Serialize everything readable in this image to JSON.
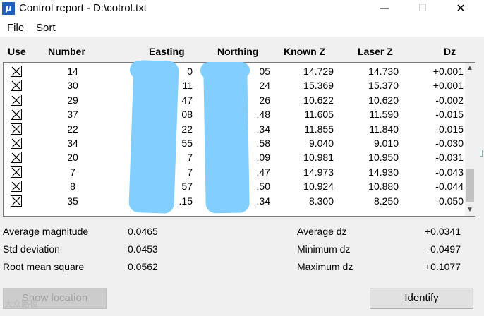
{
  "window": {
    "title": "Control report - D:\\cotrol.txt",
    "app_icon_glyph": "μ",
    "min_glyph": "—",
    "max_glyph": "☐",
    "close_glyph": "✕"
  },
  "menu": {
    "file": "File",
    "sort": "Sort"
  },
  "columns": {
    "use": "Use",
    "number": "Number",
    "easting": "Easting",
    "northing": "Northing",
    "known_z": "Known Z",
    "laser_z": "Laser Z",
    "dz": "Dz"
  },
  "rows": [
    {
      "use": true,
      "number": "14",
      "easting": "0",
      "northing": "05",
      "known_z": "14.729",
      "laser_z": "14.730",
      "dz": "+0.001"
    },
    {
      "use": true,
      "number": "30",
      "easting": "11",
      "northing": "24",
      "known_z": "15.369",
      "laser_z": "15.370",
      "dz": "+0.001"
    },
    {
      "use": true,
      "number": "29",
      "easting": "47",
      "northing": "26",
      "known_z": "10.622",
      "laser_z": "10.620",
      "dz": "-0.002"
    },
    {
      "use": true,
      "number": "37",
      "easting": "08",
      "northing": ".48",
      "known_z": "11.605",
      "laser_z": "11.590",
      "dz": "-0.015"
    },
    {
      "use": true,
      "number": "22",
      "easting": "22",
      "northing": ".34",
      "known_z": "11.855",
      "laser_z": "11.840",
      "dz": "-0.015"
    },
    {
      "use": true,
      "number": "34",
      "easting": "55",
      "northing": ".58",
      "known_z": "9.040",
      "laser_z": "9.010",
      "dz": "-0.030"
    },
    {
      "use": true,
      "number": "20",
      "easting": "7",
      "northing": ".09",
      "known_z": "10.981",
      "laser_z": "10.950",
      "dz": "-0.031"
    },
    {
      "use": true,
      "number": "7",
      "easting": "7",
      "northing": ".47",
      "known_z": "14.973",
      "laser_z": "14.930",
      "dz": "-0.043"
    },
    {
      "use": true,
      "number": "8",
      "easting": "57",
      "northing": ".50",
      "known_z": "10.924",
      "laser_z": "10.880",
      "dz": "-0.044"
    },
    {
      "use": true,
      "number": "35",
      "easting": ".15",
      "northing": ".34",
      "known_z": "8.300",
      "laser_z": "8.250",
      "dz": "-0.050"
    }
  ],
  "scroll": {
    "up": "▲",
    "down": "▼"
  },
  "stats": {
    "avg_magnitude_label": "Average magnitude",
    "avg_magnitude_value": "0.0465",
    "std_dev_label": "Std deviation",
    "std_dev_value": "0.0453",
    "rms_label": "Root mean square",
    "rms_value": "0.0562",
    "avg_dz_label": "Average dz",
    "avg_dz_value": "+0.0341",
    "min_dz_label": "Minimum dz",
    "min_dz_value": "-0.0497",
    "max_dz_label": "Maximum dz",
    "max_dz_value": "+0.1077"
  },
  "buttons": {
    "show_location": "Show location",
    "identify": "Identify"
  },
  "watermark": "大众路模",
  "colors": {
    "redaction": "#82cfff",
    "app_icon": "#1f5fbf"
  }
}
